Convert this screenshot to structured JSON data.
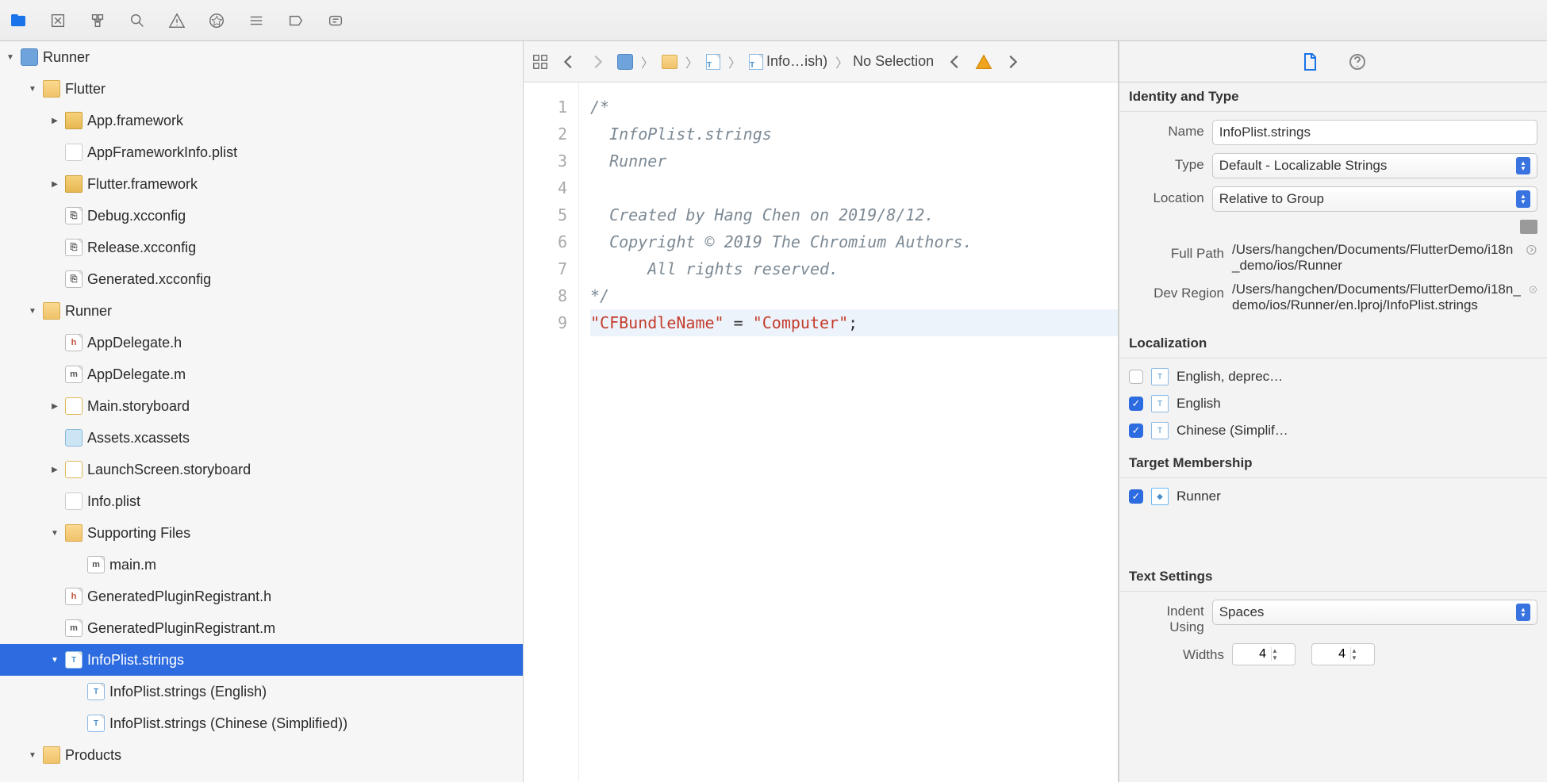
{
  "navigator": {
    "tree": [
      {
        "indent": 0,
        "disclosure": "down",
        "icon": "proj",
        "label": "Runner"
      },
      {
        "indent": 1,
        "disclosure": "down",
        "icon": "folder",
        "label": "Flutter"
      },
      {
        "indent": 2,
        "disclosure": "right",
        "icon": "framework",
        "label": "App.framework"
      },
      {
        "indent": 2,
        "disclosure": "none",
        "icon": "plist",
        "label": "AppFrameworkInfo.plist"
      },
      {
        "indent": 2,
        "disclosure": "right",
        "icon": "framework",
        "label": "Flutter.framework"
      },
      {
        "indent": 2,
        "disclosure": "none",
        "icon": "doc",
        "label": "Debug.xcconfig"
      },
      {
        "indent": 2,
        "disclosure": "none",
        "icon": "doc",
        "label": "Release.xcconfig"
      },
      {
        "indent": 2,
        "disclosure": "none",
        "icon": "doc",
        "label": "Generated.xcconfig"
      },
      {
        "indent": 1,
        "disclosure": "down",
        "icon": "folder",
        "label": "Runner"
      },
      {
        "indent": 2,
        "disclosure": "none",
        "icon": "doc-h",
        "label": "AppDelegate.h"
      },
      {
        "indent": 2,
        "disclosure": "none",
        "icon": "doc-m",
        "label": "AppDelegate.m"
      },
      {
        "indent": 2,
        "disclosure": "right",
        "icon": "storyboard",
        "label": "Main.storyboard"
      },
      {
        "indent": 2,
        "disclosure": "none",
        "icon": "xcassets",
        "label": "Assets.xcassets"
      },
      {
        "indent": 2,
        "disclosure": "right",
        "icon": "storyboard",
        "label": "LaunchScreen.storyboard"
      },
      {
        "indent": 2,
        "disclosure": "none",
        "icon": "plist",
        "label": "Info.plist"
      },
      {
        "indent": 2,
        "disclosure": "down",
        "icon": "folder",
        "label": "Supporting Files"
      },
      {
        "indent": 3,
        "disclosure": "none",
        "icon": "doc-m",
        "label": "main.m"
      },
      {
        "indent": 2,
        "disclosure": "none",
        "icon": "doc-h",
        "label": "GeneratedPluginRegistrant.h"
      },
      {
        "indent": 2,
        "disclosure": "none",
        "icon": "doc-m",
        "label": "GeneratedPluginRegistrant.m"
      },
      {
        "indent": 2,
        "disclosure": "down",
        "icon": "strings",
        "label": "InfoPlist.strings",
        "selected": true
      },
      {
        "indent": 3,
        "disclosure": "none",
        "icon": "strings",
        "label": "InfoPlist.strings (English)"
      },
      {
        "indent": 3,
        "disclosure": "none",
        "icon": "strings",
        "label": "InfoPlist.strings (Chinese (Simplified))"
      },
      {
        "indent": 1,
        "disclosure": "down",
        "icon": "folder",
        "label": "Products"
      }
    ]
  },
  "jumpbar": {
    "breadcrumb_file": "Info…ish)",
    "no_selection": "No Selection"
  },
  "code": {
    "lines": [
      "/*",
      "  InfoPlist.strings",
      "  Runner",
      "",
      "  Created by Hang Chen on 2019/8/12.",
      "  Copyright © 2019 The Chromium Authors. All rights reserved.",
      "*/"
    ],
    "key": "\"CFBundleName\"",
    "eq": " = ",
    "val": "\"Computer\"",
    "semicolon": ";",
    "line_numbers": [
      "1",
      "2",
      "3",
      "4",
      "5",
      "6",
      "7",
      "8",
      "9"
    ]
  },
  "inspector": {
    "identity_header": "Identity and Type",
    "name_label": "Name",
    "name_value": "InfoPlist.strings",
    "type_label": "Type",
    "type_value": "Default - Localizable Strings",
    "location_label": "Location",
    "location_value": "Relative to Group",
    "fullpath_label": "Full Path",
    "fullpath_value": "/Users/hangchen/Documents/FlutterDemo/i18n_demo/ios/Runner",
    "devregion_label": "Dev Region",
    "devregion_value": "/Users/hangchen/Documents/FlutterDemo/i18n_demo/ios/Runner/en.lproj/InfoPlist.strings",
    "localization_header": "Localization",
    "loc_items": [
      {
        "checked": false,
        "label": "English, deprec…"
      },
      {
        "checked": true,
        "label": "English"
      },
      {
        "checked": true,
        "label": "Chinese (Simplif…"
      }
    ],
    "target_header": "Target Membership",
    "target_item": {
      "checked": true,
      "label": "Runner"
    },
    "text_settings_header": "Text Settings",
    "indent_label": "Indent Using",
    "indent_value": "Spaces",
    "widths_label": "Widths",
    "width_tab": "4",
    "width_indent": "4"
  }
}
